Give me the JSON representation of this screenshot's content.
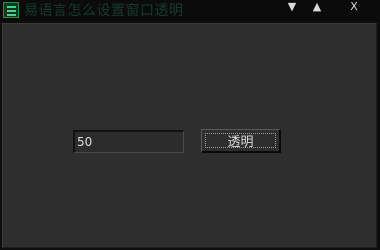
{
  "window": {
    "title": "易语言怎么设置窗口透明"
  },
  "titlebar_controls": {
    "minimize_glyph": "▼",
    "maximize_glyph": "▲",
    "close_glyph": "X"
  },
  "form": {
    "transparency_value": "50",
    "button_label": "透明"
  },
  "colors": {
    "titlebar_bg": "#0b0b0b",
    "client_bg": "#2e2e2e",
    "icon_accent": "#4fd08a"
  }
}
